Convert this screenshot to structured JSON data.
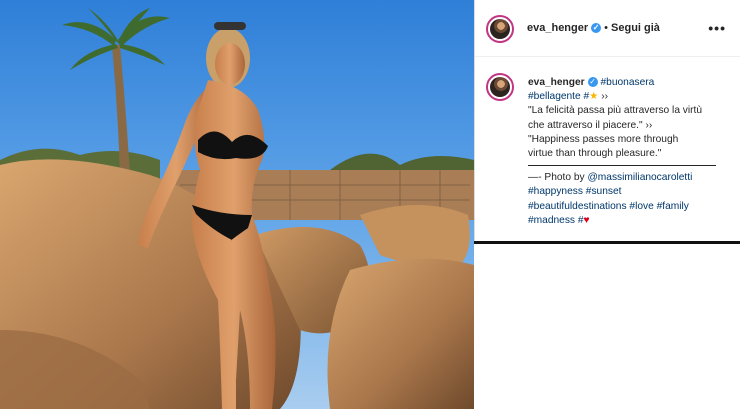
{
  "header": {
    "username": "eva_henger",
    "separator": "•",
    "follow_label": "Segui già",
    "more_label": "•••"
  },
  "caption": {
    "username": "eva_henger",
    "tag_buonasera": "#buonasera",
    "tag_bellagente": "#bellagente",
    "hash_before_star": "#",
    "star_emoji": "★",
    "arrows_1": "››",
    "italian_line_1": "\"La felicità passa più attraverso la virtù",
    "italian_line_2": "che attraverso il piacere.\"",
    "arrows_2": "››",
    "english_line_1": "\"Happiness passes more through",
    "english_line_2": "virtue than through pleasure.\"",
    "photo_prefix": "—- Photo by",
    "photo_mention": "@massimilianocaroletti",
    "tag_happyness": "#happyness",
    "tag_sunset": "#sunset",
    "tag_beautifuldestinations": "#beautifuldestinations",
    "tag_love": "#love",
    "tag_family": "#family",
    "tag_madness": "#madness",
    "hash_before_heart": "#",
    "heart_emoji": "♥"
  },
  "colors": {
    "link": "#00376b",
    "verified": "#3897f0",
    "text": "#262626"
  }
}
